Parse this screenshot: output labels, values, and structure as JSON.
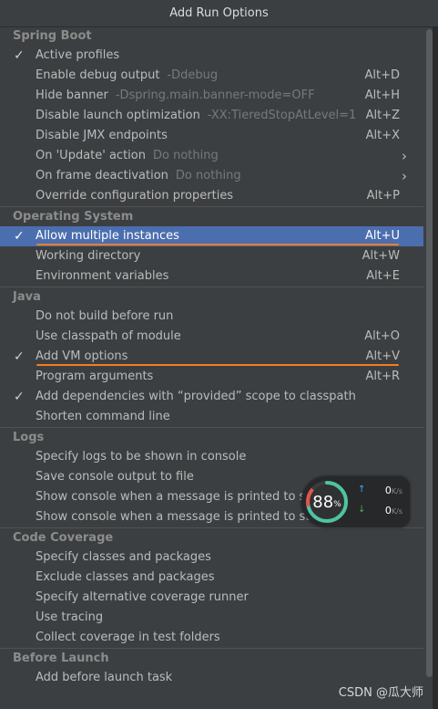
{
  "window": {
    "title": "Add Run Options"
  },
  "sections": [
    {
      "title": "Spring Boot",
      "items": [
        {
          "label": "Active profiles",
          "checked": true,
          "hint": "",
          "shortcut": "",
          "submenu": false
        },
        {
          "label": "Enable debug output",
          "checked": false,
          "hint": "-Ddebug",
          "shortcut": "Alt+D",
          "submenu": false
        },
        {
          "label": "Hide banner",
          "checked": false,
          "hint": "-Dspring.main.banner-mode=OFF",
          "shortcut": "Alt+H",
          "submenu": false
        },
        {
          "label": "Disable launch optimization",
          "checked": false,
          "hint": "-XX:TieredStopAtLevel=1",
          "shortcut": "Alt+Z",
          "submenu": false
        },
        {
          "label": "Disable JMX endpoints",
          "checked": false,
          "hint": "",
          "shortcut": "Alt+X",
          "submenu": false
        },
        {
          "label": "On 'Update' action",
          "checked": false,
          "hint": "Do nothing",
          "shortcut": "",
          "submenu": true
        },
        {
          "label": "On frame deactivation",
          "checked": false,
          "hint": "Do nothing",
          "shortcut": "",
          "submenu": true
        },
        {
          "label": "Override configuration properties",
          "checked": false,
          "hint": "",
          "shortcut": "Alt+P",
          "submenu": false
        }
      ]
    },
    {
      "title": "Operating System",
      "items": [
        {
          "label": "Allow multiple instances",
          "checked": true,
          "hint": "",
          "shortcut": "Alt+U",
          "submenu": false,
          "selected": true,
          "underlined": true
        },
        {
          "label": "Working directory",
          "checked": false,
          "hint": "",
          "shortcut": "Alt+W",
          "submenu": false
        },
        {
          "label": "Environment variables",
          "checked": false,
          "hint": "",
          "shortcut": "Alt+E",
          "submenu": false
        }
      ]
    },
    {
      "title": "Java",
      "items": [
        {
          "label": "Do not build before run",
          "checked": false,
          "hint": "",
          "shortcut": "",
          "submenu": false
        },
        {
          "label": "Use classpath of module",
          "checked": false,
          "hint": "",
          "shortcut": "Alt+O",
          "submenu": false
        },
        {
          "label": "Add VM options",
          "checked": true,
          "hint": "",
          "shortcut": "Alt+V",
          "submenu": false,
          "underlined": true
        },
        {
          "label": "Program arguments",
          "checked": false,
          "hint": "",
          "shortcut": "Alt+R",
          "submenu": false
        },
        {
          "label": "Add dependencies with “provided” scope to classpath",
          "checked": true,
          "hint": "",
          "shortcut": "",
          "submenu": false
        },
        {
          "label": "Shorten command line",
          "checked": false,
          "hint": "",
          "shortcut": "",
          "submenu": false
        }
      ]
    },
    {
      "title": "Logs",
      "items": [
        {
          "label": "Specify logs to be shown in console",
          "checked": false,
          "hint": "",
          "shortcut": "",
          "submenu": false
        },
        {
          "label": "Save console output to file",
          "checked": false,
          "hint": "",
          "shortcut": "",
          "submenu": false
        },
        {
          "label": "Show console when a message is printed to stdout",
          "checked": false,
          "hint": "",
          "shortcut": "",
          "submenu": false
        },
        {
          "label": "Show console when a message is printed to stderr",
          "checked": false,
          "hint": "",
          "shortcut": "",
          "submenu": false
        }
      ]
    },
    {
      "title": "Code Coverage",
      "items": [
        {
          "label": "Specify classes and packages",
          "checked": false,
          "hint": "",
          "shortcut": "",
          "submenu": false
        },
        {
          "label": "Exclude classes and packages",
          "checked": false,
          "hint": "",
          "shortcut": "",
          "submenu": false
        },
        {
          "label": "Specify alternative coverage runner",
          "checked": false,
          "hint": "",
          "shortcut": "",
          "submenu": false
        },
        {
          "label": "Use tracing",
          "checked": false,
          "hint": "",
          "shortcut": "",
          "submenu": false
        },
        {
          "label": "Collect coverage in test folders",
          "checked": false,
          "hint": "",
          "shortcut": "",
          "submenu": false
        }
      ]
    },
    {
      "title": "Before Launch",
      "items": [
        {
          "label": "Add before launch task",
          "checked": false,
          "hint": "",
          "shortcut": "",
          "submenu": false
        }
      ]
    }
  ],
  "icons": {
    "check": "checkmark-icon",
    "submenu": "chevron-right-icon"
  },
  "colors": {
    "selection": "#4b6eaf",
    "underline": "#f57d1f",
    "background": "#3c3f41"
  },
  "monitor": {
    "percent": 88,
    "percent_unit": "%",
    "upload": "0",
    "download": "0",
    "rate_unit": "K/s"
  },
  "watermark": "CSDN @瓜大师"
}
